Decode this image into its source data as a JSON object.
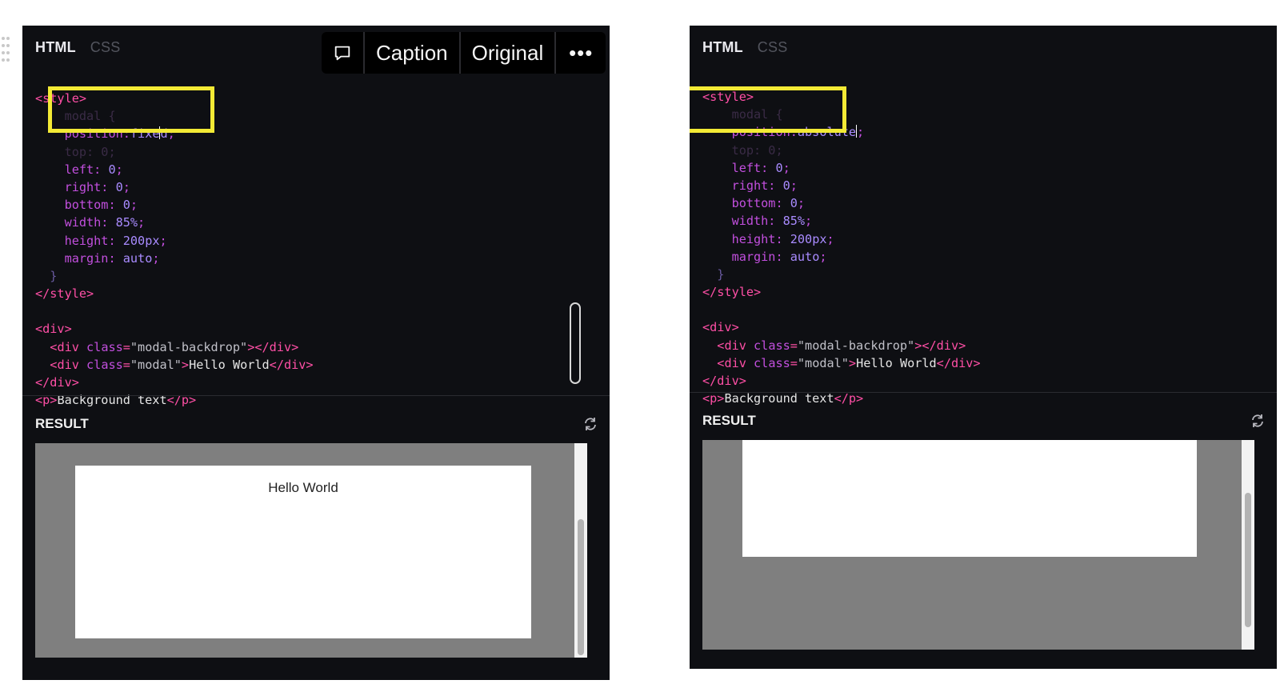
{
  "editor_tabs": {
    "html": "HTML",
    "css": "CSS"
  },
  "toolbar": {
    "caption_label": "Caption",
    "original_label": "Original",
    "more_label": "•••"
  },
  "code_common": {
    "style_open": "<style>",
    "ghost_selector": "modal {",
    "ghost_top": "top: 0;",
    "left": "left",
    "right": "right",
    "bottom": "bottom",
    "width": "width",
    "height": "height",
    "margin": "margin",
    "zero": "0",
    "width_value": "85%",
    "height_value": "200px",
    "margin_value": "auto",
    "colon": ":",
    "semicolon": ";",
    "close_brace": "}",
    "style_close": "</style>",
    "div_open": "<div>",
    "div_close": "</div>",
    "tag_div_open": "<div",
    "attr_class": "class",
    "eq": "=",
    "backdrop_class": "\"modal-backdrop\"",
    "modal_class": "\"modal\"",
    "gt": ">",
    "tag_div_close": "</div>",
    "modal_text": "Hello World",
    "p_open": "<p>",
    "p_text": "Background text",
    "p_close": "</p>",
    "position_prop": "position"
  },
  "left_panel": {
    "position_value_a": "fixe",
    "position_value_b": "d"
  },
  "right_panel": {
    "position_value": "absolute"
  },
  "result": {
    "label": "RESULT",
    "modal_text_left": "Hello World"
  }
}
